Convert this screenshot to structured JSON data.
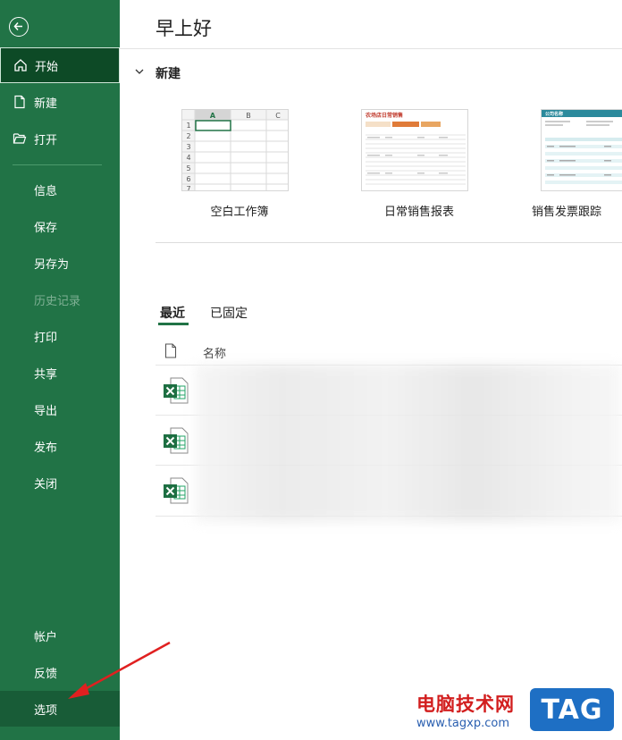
{
  "sidebar": {
    "top_items": [
      {
        "label": "开始",
        "icon": "home-icon"
      },
      {
        "label": "新建",
        "icon": "new-document-icon"
      },
      {
        "label": "打开",
        "icon": "folder-open-icon"
      }
    ],
    "middle_items": [
      {
        "label": "信息"
      },
      {
        "label": "保存"
      },
      {
        "label": "另存为"
      },
      {
        "label": "历史记录",
        "disabled": true
      },
      {
        "label": "打印"
      },
      {
        "label": "共享"
      },
      {
        "label": "导出"
      },
      {
        "label": "发布"
      },
      {
        "label": "关闭"
      }
    ],
    "bottom_items": [
      {
        "label": "帐户"
      },
      {
        "label": "反馈"
      },
      {
        "label": "选项"
      }
    ]
  },
  "main": {
    "greeting": "早上好",
    "new_section": {
      "title": "新建",
      "templates": [
        {
          "label": "空白工作簿"
        },
        {
          "label": "日常销售报表"
        },
        {
          "label": "销售发票跟踪"
        }
      ]
    },
    "tabs": [
      "最近",
      "已固定"
    ],
    "columns": {
      "name": "名称"
    }
  },
  "blank_thumb": {
    "cols": [
      "A",
      "B",
      "C"
    ],
    "rows": [
      "1",
      "2",
      "3",
      "4",
      "5",
      "6",
      "7"
    ]
  },
  "sales_thumb": {
    "title": "农场店日常销售"
  },
  "invoice_thumb": {
    "title": "公司名称"
  },
  "watermark": {
    "text": "电脑技术网",
    "url": "www.tagxp.com",
    "tag": "TAG"
  },
  "colors": {
    "sidebar": "#217346",
    "active": "#0d4a26",
    "accent": "#217346"
  }
}
